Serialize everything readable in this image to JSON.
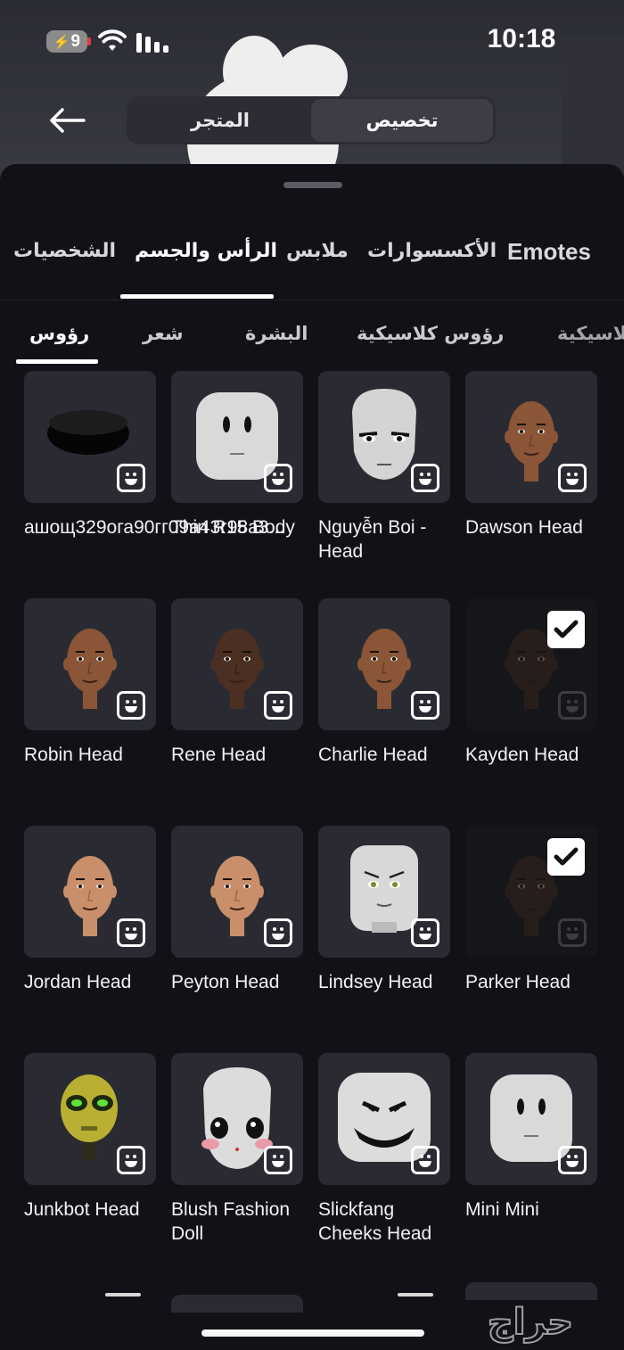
{
  "status": {
    "battery": "9",
    "time": "10:18"
  },
  "header": {
    "segments": [
      {
        "label": "تخصيص",
        "active": true
      },
      {
        "label": "المتجر",
        "active": false
      }
    ]
  },
  "categories": [
    {
      "label": "Emotes",
      "active": false
    },
    {
      "label": "الأكسسوارات",
      "active": false
    },
    {
      "label": "ملابس",
      "active": false
    },
    {
      "label": "الرأس والجسم",
      "active": true
    },
    {
      "label": "الشخصيات",
      "active": false
    }
  ],
  "subcategories": [
    {
      "label": "كلاسيكية",
      "active": false
    },
    {
      "label": "رؤوس كلاسيكية",
      "active": false
    },
    {
      "label": "البشرة",
      "active": false
    },
    {
      "label": "شعر",
      "active": false
    },
    {
      "label": "رؤوس",
      "active": true
    }
  ],
  "items": [
    {
      "name": "ашощ329ога90гг09а43г98а3...",
      "art": "black-puck",
      "equipped": false
    },
    {
      "name": "Thin R15 Body",
      "art": "block-head",
      "equipped": false
    },
    {
      "name": "Nguyễn Boi - Head",
      "art": "boi-head",
      "equipped": false
    },
    {
      "name": "Dawson Head",
      "art": "human-medium",
      "equipped": false
    },
    {
      "name": "Robin Head",
      "art": "human-medium",
      "equipped": false
    },
    {
      "name": "Rene Head",
      "art": "human-dark",
      "equipped": false
    },
    {
      "name": "Charlie Head",
      "art": "human-medium",
      "equipped": false
    },
    {
      "name": "Kayden Head",
      "art": "human-dark",
      "equipped": true
    },
    {
      "name": "Jordan Head",
      "art": "human-light",
      "equipped": false
    },
    {
      "name": "Peyton Head",
      "art": "human-light",
      "equipped": false
    },
    {
      "name": "Lindsey Head",
      "art": "lindsey-head",
      "equipped": false
    },
    {
      "name": "Parker Head",
      "art": "human-dark",
      "equipped": true
    },
    {
      "name": "Junkbot Head",
      "art": "junkbot",
      "equipped": false
    },
    {
      "name": "Blush Fashion Doll",
      "art": "doll-head",
      "equipped": false
    },
    {
      "name": "Slickfang Cheeks Head",
      "art": "slickfang",
      "equipped": false
    },
    {
      "name": "Mini Mini",
      "art": "block-head",
      "equipped": false
    }
  ],
  "icons": {
    "back": "arrow-left-icon",
    "emote_badge": "smiley-icon",
    "equipped": "checkmark-icon"
  },
  "watermark": "حراج"
}
